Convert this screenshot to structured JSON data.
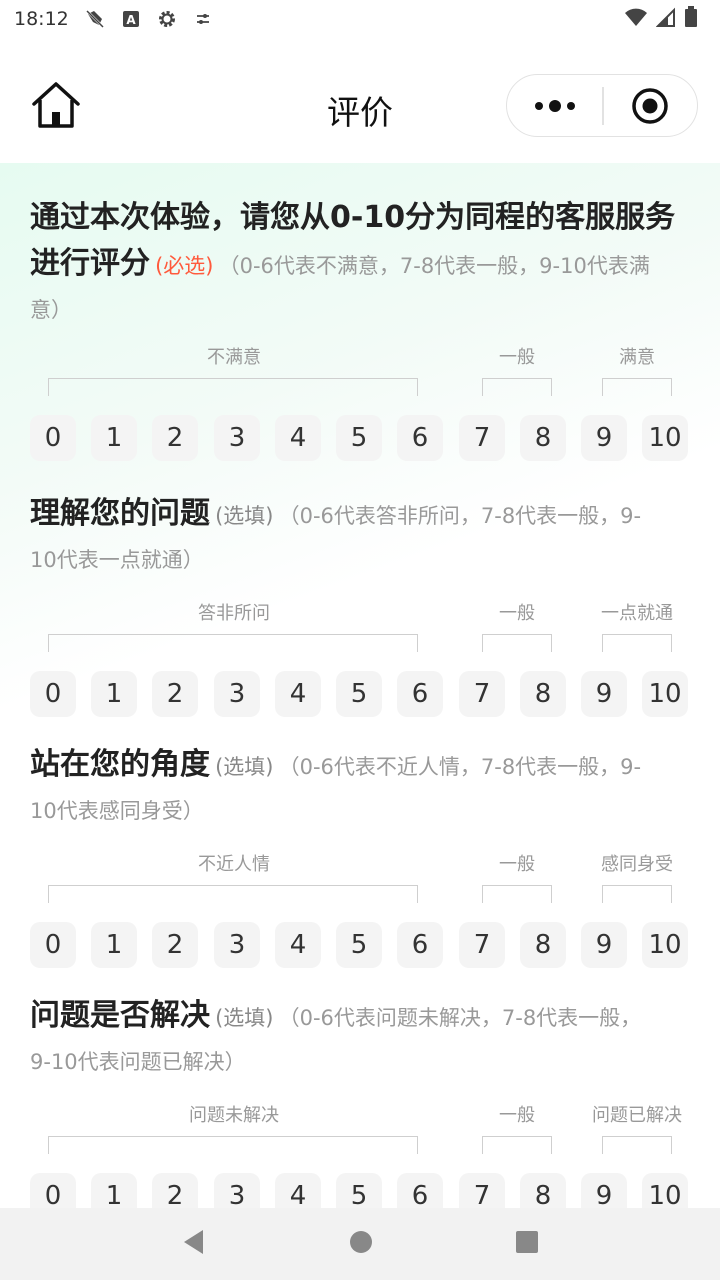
{
  "status_bar": {
    "time": "18:12",
    "icons_left": [
      "sync-off-icon",
      "a-badge-icon",
      "gear-icon",
      "tune-icon"
    ],
    "icons_right": [
      "wifi-icon",
      "signal-icon",
      "battery-icon"
    ]
  },
  "nav": {
    "title": "评价",
    "home_icon": "home-icon",
    "more_icon": "more-dots-icon",
    "target_icon": "target-icon"
  },
  "questions": [
    {
      "title_line1": "通过本次体验，请您从0-10分为同程的客服服务",
      "title_line2": "进行评分",
      "flag": "(必选)",
      "desc_inline": "（0-6代表不满意，7-8代表一般，9-10代表满",
      "desc_tail": "意）",
      "labels": [
        "不满意",
        "一般",
        "满意"
      ],
      "scores": [
        "0",
        "1",
        "2",
        "3",
        "4",
        "5",
        "6",
        "7",
        "8",
        "9",
        "10"
      ]
    },
    {
      "title_line1": "理解您的问题",
      "flag": "(选填)",
      "desc_inline": "（0-6代表答非所问，7-8代表一般，9-",
      "desc_tail": "10代表一点就通）",
      "labels": [
        "答非所问",
        "一般",
        "一点就通"
      ],
      "scores": [
        "0",
        "1",
        "2",
        "3",
        "4",
        "5",
        "6",
        "7",
        "8",
        "9",
        "10"
      ]
    },
    {
      "title_line1": "站在您的角度",
      "flag": "(选填)",
      "desc_inline": "（0-6代表不近人情，7-8代表一般，9-",
      "desc_tail": "10代表感同身受）",
      "labels": [
        "不近人情",
        "一般",
        "感同身受"
      ],
      "scores": [
        "0",
        "1",
        "2",
        "3",
        "4",
        "5",
        "6",
        "7",
        "8",
        "9",
        "10"
      ]
    },
    {
      "title_line1": "问题是否解决",
      "flag": "(选填)",
      "desc_inline": "（0-6代表问题未解决，7-8代表一般，",
      "desc_tail": "9-10代表问题已解决）",
      "labels": [
        "问题未解决",
        "一般",
        "问题已解决"
      ],
      "scores": [
        "0",
        "1",
        "2",
        "3",
        "4",
        "5",
        "6",
        "7",
        "8",
        "9",
        "10"
      ]
    }
  ],
  "sys_nav": {
    "back_icon": "back-triangle-icon",
    "home_icon": "home-circle-icon",
    "recents_icon": "recents-square-icon"
  }
}
